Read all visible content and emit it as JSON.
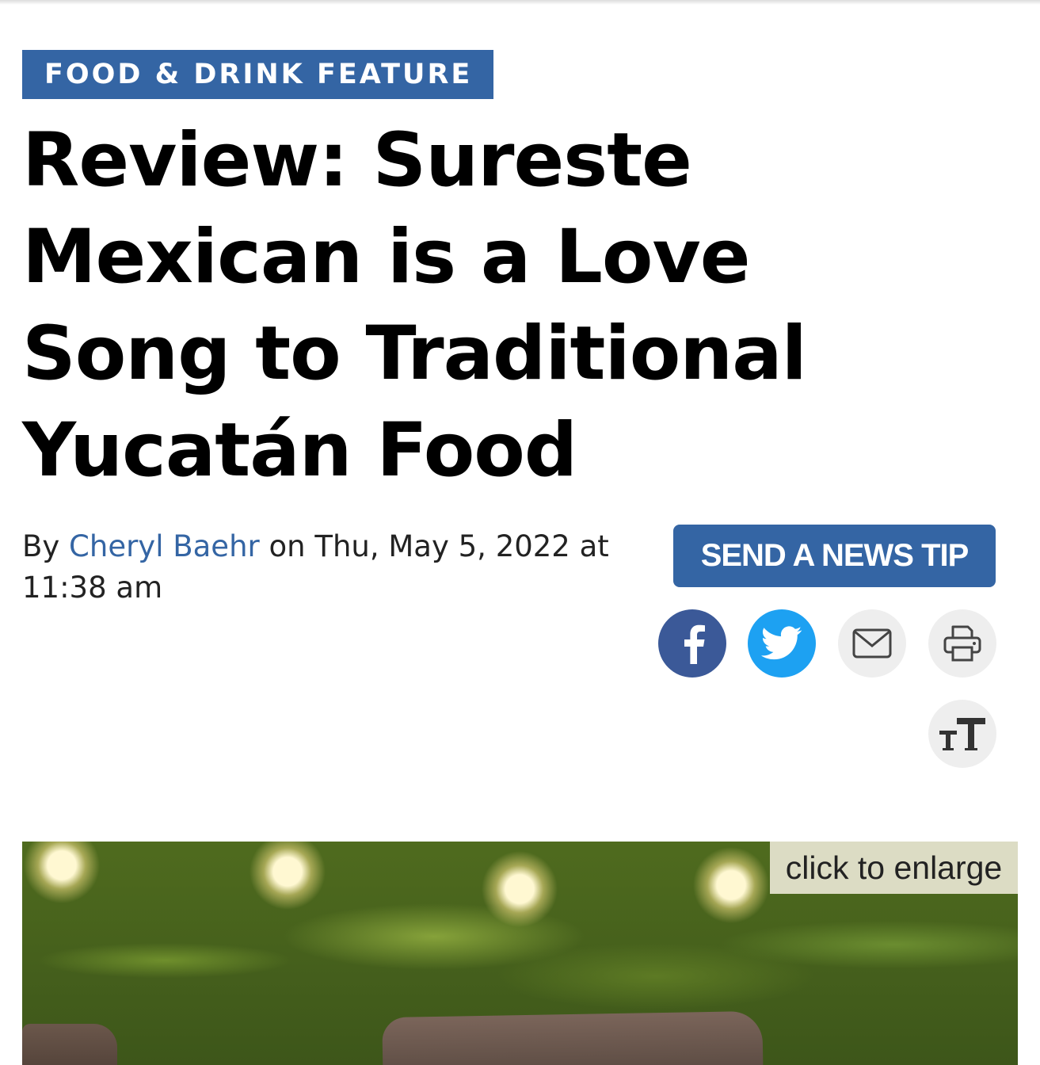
{
  "section_label": "FOOD & DRINK FEATURE",
  "headline": "Review: Sureste Mexican is a Love Song to Traditional Yucatán Food",
  "byline": {
    "prefix": "By",
    "author": "Cheryl Baehr",
    "date_text": "on Thu, May 5, 2022 at 11:38 am"
  },
  "news_tip_button": "SEND A NEWS TIP",
  "share": {
    "facebook_icon": "facebook-icon",
    "twitter_icon": "twitter-icon",
    "email_icon": "email-icon",
    "print_icon": "print-icon",
    "text_size_icon": "text-size-icon"
  },
  "photo": {
    "enlarge_label": "click to enlarge"
  },
  "colors": {
    "brand_blue": "#3465a4",
    "facebook": "#3b5998",
    "twitter": "#1da1f2",
    "icon_bg": "#eeeeee"
  }
}
